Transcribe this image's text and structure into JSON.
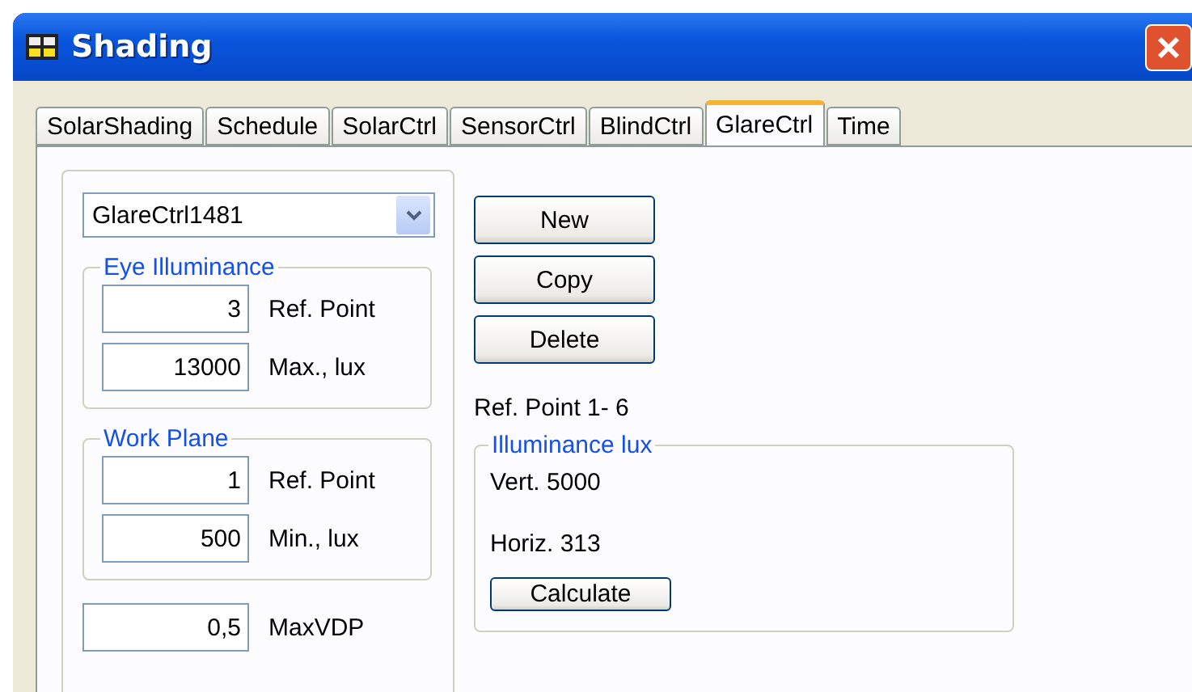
{
  "window": {
    "title": "Shading"
  },
  "tabs": [
    {
      "label": "SolarShading",
      "selected": false
    },
    {
      "label": "Schedule",
      "selected": false
    },
    {
      "label": "SolarCtrl",
      "selected": false
    },
    {
      "label": "SensorCtrl",
      "selected": false
    },
    {
      "label": "BlindCtrl",
      "selected": false
    },
    {
      "label": "GlareCtrl",
      "selected": true
    },
    {
      "label": "Time",
      "selected": false
    }
  ],
  "selector": {
    "value": "GlareCtrl1481"
  },
  "groups": [
    {
      "title": "Eye Illuminance",
      "fields": [
        {
          "value": "3",
          "label": "Ref. Point"
        },
        {
          "value": "13000",
          "label": "Max., lux"
        }
      ]
    },
    {
      "title": "Work Plane",
      "fields": [
        {
          "value": "1",
          "label": "Ref. Point"
        },
        {
          "value": "500",
          "label": "Min., lux"
        }
      ]
    }
  ],
  "max_vdp": {
    "value": "0,5",
    "label": "MaxVDP"
  },
  "buttons": [
    "New",
    "Copy",
    "Delete"
  ],
  "ref_point_range": "Ref. Point 1- 6",
  "illuminance": {
    "title": "Illuminance lux",
    "vertical": "Vert. 5000",
    "horizontal": "Horiz. 313",
    "button": "Calculate"
  }
}
